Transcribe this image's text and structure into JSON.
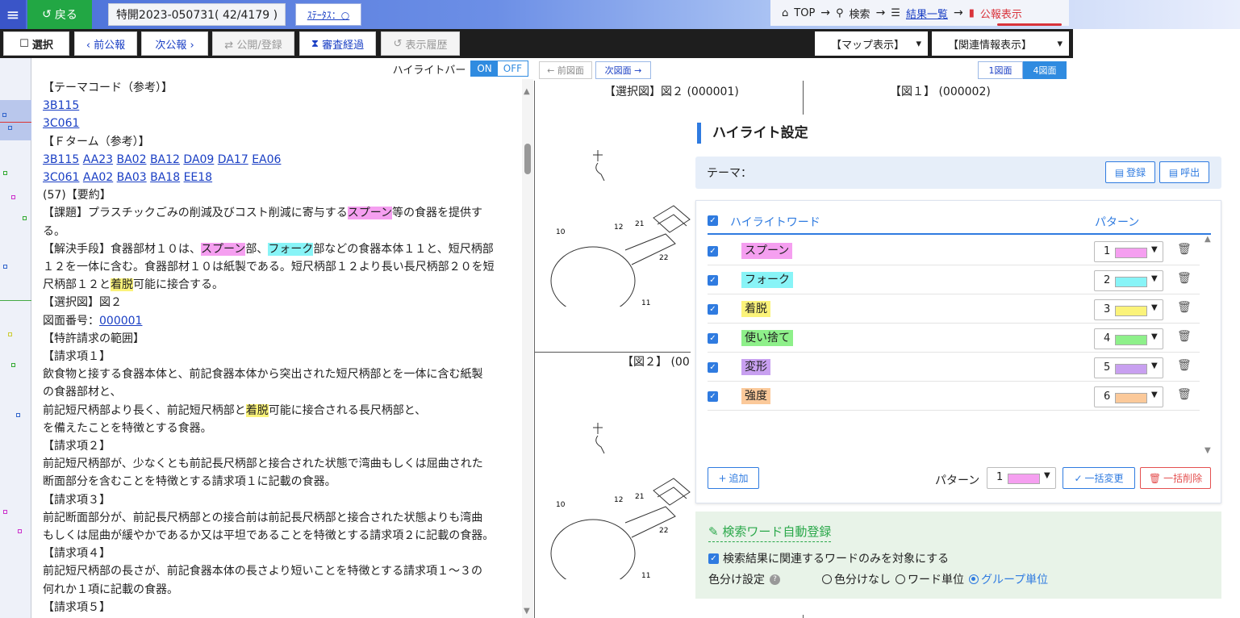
{
  "topbar": {
    "menu_icon": "hamburger-icon",
    "back_label": "戻る",
    "doc_number": "特開2023-050731( 42/4179 )",
    "status_label": "ｽﾃｰﾀｽ：○",
    "breadcrumb": {
      "top": "TOP",
      "search": "検索",
      "results": "結果一覧",
      "current": "公報表示"
    }
  },
  "toolbar": {
    "select": "選択",
    "prev": "‹ 前公報",
    "next": "次公報 ›",
    "publish": "⇄ 公開/登録",
    "exam": "審査経過",
    "history": "表示履歴",
    "map_view": "【マップ表示】",
    "related": "【関連情報表示】"
  },
  "highlight_bar": {
    "label": "ハイライトバー",
    "on": "ON",
    "off": "OFF"
  },
  "text_lines": [
    {
      "segs": [
        {
          "t": "【テーマコード（参考）】"
        }
      ]
    },
    {
      "segs": [
        {
          "t": "3B115",
          "link": true
        }
      ]
    },
    {
      "segs": [
        {
          "t": "3C061",
          "link": true
        }
      ]
    },
    {
      "segs": [
        {
          "t": "【Ｆターム（参考）】"
        }
      ]
    },
    {
      "segs": [
        {
          "t": "3B115",
          "link": true
        },
        {
          "t": " "
        },
        {
          "t": "AA23",
          "link": true
        },
        {
          "t": "  "
        },
        {
          "t": "BA02",
          "link": true
        },
        {
          "t": "  "
        },
        {
          "t": "BA12",
          "link": true
        },
        {
          "t": "  "
        },
        {
          "t": "DA09",
          "link": true
        },
        {
          "t": "  "
        },
        {
          "t": "DA17",
          "link": true
        },
        {
          "t": "  "
        },
        {
          "t": "EA06",
          "link": true
        }
      ]
    },
    {
      "segs": [
        {
          "t": "3C061",
          "link": true
        },
        {
          "t": " "
        },
        {
          "t": "AA02",
          "link": true
        },
        {
          "t": "  "
        },
        {
          "t": "BA03",
          "link": true
        },
        {
          "t": "  "
        },
        {
          "t": "BA18",
          "link": true
        },
        {
          "t": "  "
        },
        {
          "t": "EE18",
          "link": true
        }
      ]
    },
    {
      "segs": [
        {
          "t": "(57)【要約】"
        }
      ]
    },
    {
      "segs": [
        {
          "t": "【課題】プラスチックごみの削減及びコスト削減に寄与する"
        },
        {
          "t": "スプーン",
          "hl": 1
        },
        {
          "t": "等の食器を提供す"
        }
      ]
    },
    {
      "segs": [
        {
          "t": "る。"
        }
      ]
    },
    {
      "segs": [
        {
          "t": "【解決手段】食器部材１０は、"
        },
        {
          "t": "スプーン",
          "hl": 1
        },
        {
          "t": "部、"
        },
        {
          "t": "フォーク",
          "hl": 2
        },
        {
          "t": "部などの食器本体１１と、短尺柄部"
        }
      ]
    },
    {
      "segs": [
        {
          "t": "１２を一体に含む。食器部材１０は紙製である。短尺柄部１２より長い長尺柄部２０を短"
        }
      ]
    },
    {
      "segs": [
        {
          "t": "尺柄部１２と"
        },
        {
          "t": "着脱",
          "hl": 3
        },
        {
          "t": "可能に接合する。"
        }
      ]
    },
    {
      "segs": [
        {
          "t": "【選択図】図２"
        }
      ]
    },
    {
      "segs": [
        {
          "t": "図面番号："
        },
        {
          "t": "000001",
          "link": true
        }
      ]
    },
    {
      "segs": [
        {
          "t": "【特許請求の範囲】"
        }
      ]
    },
    {
      "segs": [
        {
          "t": "【請求項１】"
        }
      ]
    },
    {
      "segs": [
        {
          "t": "  飲食物と接する食器本体と、前記食器本体から突出された短尺柄部とを一体に含む紙製"
        }
      ]
    },
    {
      "segs": [
        {
          "t": "の食器部材と、"
        }
      ]
    },
    {
      "segs": [
        {
          "t": "  前記短尺柄部より長く、前記短尺柄部と"
        },
        {
          "t": "着脱",
          "hl": 3
        },
        {
          "t": "可能に接合される長尺柄部と、"
        }
      ]
    },
    {
      "segs": [
        {
          "t": "  を備えたことを特徴とする食器。"
        }
      ]
    },
    {
      "segs": [
        {
          "t": "【請求項２】"
        }
      ]
    },
    {
      "segs": [
        {
          "t": "  前記短尺柄部が、少なくとも前記長尺柄部と接合された状態で湾曲もしくは屈曲された"
        }
      ]
    },
    {
      "segs": [
        {
          "t": "断面部分を含むことを特徴とする請求項１に記載の食器。"
        }
      ]
    },
    {
      "segs": [
        {
          "t": "【請求項３】"
        }
      ]
    },
    {
      "segs": [
        {
          "t": "  前記断面部分が、前記長尺柄部との接合前は前記長尺柄部と接合された状態よりも湾曲"
        }
      ]
    },
    {
      "segs": [
        {
          "t": "もしくは屈曲が緩やかであるか又は平坦であることを特徴とする請求項２に記載の食器。"
        }
      ]
    },
    {
      "segs": [
        {
          "t": "【請求項４】"
        }
      ]
    },
    {
      "segs": [
        {
          "t": "  前記短尺柄部の長さが、前記食器本体の長さより短いことを特徴とする請求項１～３の"
        }
      ]
    },
    {
      "segs": [
        {
          "t": "何れか１項に記載の食器。"
        }
      ]
    },
    {
      "segs": [
        {
          "t": "【請求項５】"
        }
      ]
    }
  ],
  "figure_bar": {
    "prev": "← 前図面",
    "next": "次図面 →",
    "one": "1図面",
    "four": "4図面"
  },
  "figures": {
    "selected_label": "【選択図】図２ (000001)",
    "fig1_label": "【図１】 (000002)",
    "fig2_label": "【図２】 (00",
    "part_labels": [
      "10",
      "12",
      "21",
      "22",
      "11"
    ]
  },
  "dialog": {
    "title": "ハイライト設定",
    "theme_label": "テーマ：",
    "register": "登録",
    "recall": "呼出",
    "col_word": "ハイライトワード",
    "col_pattern": "パターン",
    "words": [
      {
        "word": "スプーン",
        "pattern": "1",
        "color": "#f59ff0"
      },
      {
        "word": "フォーク",
        "pattern": "2",
        "color": "#88f4f7"
      },
      {
        "word": "着脱",
        "pattern": "3",
        "color": "#fbf37a"
      },
      {
        "word": "使い捨て",
        "pattern": "4",
        "color": "#8ef08a"
      },
      {
        "word": "変形",
        "pattern": "5",
        "color": "#c8a0f0"
      },
      {
        "word": "強度",
        "pattern": "6",
        "color": "#fbc99a"
      }
    ],
    "add": "追加",
    "pattern_label": "パターン",
    "pattern_all": "1",
    "pattern_all_color": "#f59ff0",
    "bulk_change": "一括変更",
    "bulk_delete": "一括削除",
    "auto_title": "検索ワード自動登録",
    "auto_check": "検索結果に関連するワードのみを対象にする",
    "color_setting": "色分け設定",
    "radio_none": "色分けなし",
    "radio_word": "ワード単位",
    "radio_group": "グループ単位"
  }
}
